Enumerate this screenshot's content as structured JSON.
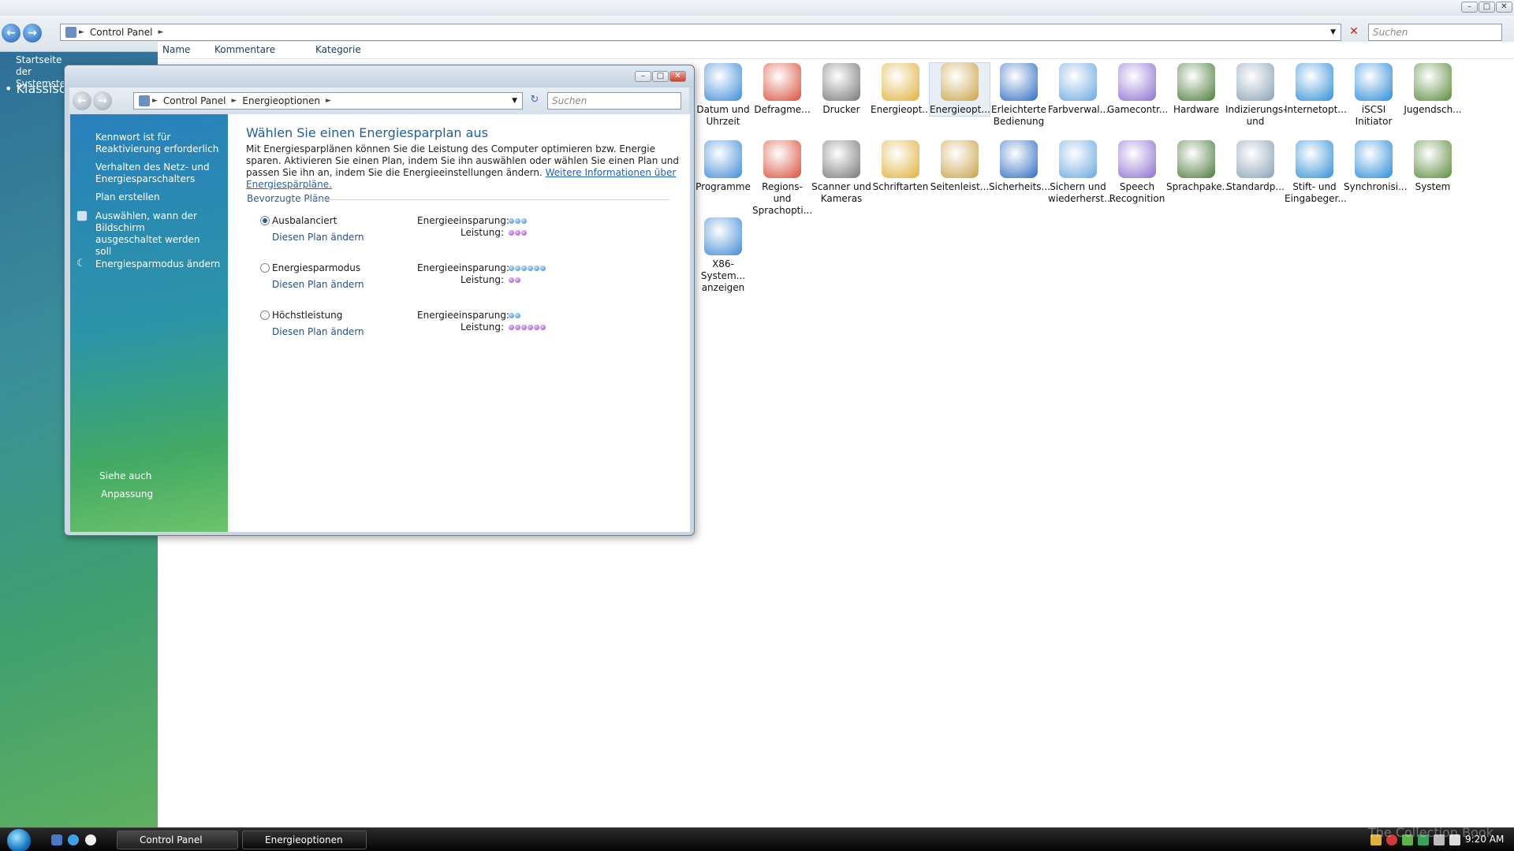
{
  "main": {
    "address": {
      "segments": [
        "Control Panel"
      ]
    },
    "search_placeholder": "Suchen",
    "sidebar": {
      "startseite": "Startseite der Systemsteu",
      "klassisch": "Klassisch"
    },
    "columns": [
      "Name",
      "Kommentare",
      "Kategorie"
    ],
    "items_row1": [
      "Datum und Uhrzeit",
      "Defragme...",
      "Drucker",
      "Energieopt...",
      "Energieopt...",
      "Erleichterte Bedienung",
      "Farbverwal...",
      "Gamecontr...",
      "Hardware",
      "Indizierungs- und",
      "Internetopt...",
      "iSCSI Initiator",
      "Jugendsch..."
    ],
    "items_row2": [
      "Programme",
      "Regions- und Sprachopti...",
      "Scanner und Kameras",
      "Schriftarten",
      "Seitenleist...",
      "Sicherheits...",
      "Sichern und wiederherst...",
      "Speech Recognition",
      "Sprachpake...",
      "Standardp...",
      "Stift- und Eingabeger...",
      "Synchronisi...",
      "System"
    ],
    "items_row3": [
      "X86-System... anzeigen"
    ]
  },
  "power": {
    "address": {
      "segments": [
        "Control Panel",
        "Energieoptionen"
      ]
    },
    "search_placeholder": "Suchen",
    "tasks": [
      "Kennwort ist für Reaktivierung erforderlich",
      "Verhalten des Netz- und Energiesparschalters",
      "Plan erstellen",
      "Auswählen, wann der Bildschirm ausgeschaltet werden soll",
      "Energiesparmodus ändern"
    ],
    "see_also": {
      "heading": "Siehe auch",
      "links": [
        "Anpassung"
      ]
    },
    "title": "Wählen Sie einen Energiesparplan aus",
    "intro": "Mit Energiesparplänen können Sie die Leistung des Computer optimieren bzw. Energie sparen. Aktivieren Sie einen Plan, indem Sie ihn auswählen oder wählen Sie einen Plan und passen Sie ihn an, indem Sie die Energieeinstellungen ändern.",
    "intro_link": "Weitere Informationen über Energiespärpläne.",
    "section": "Bevorzugte Pläne",
    "labels": {
      "savings": "Energieeinsparung:",
      "performance": "Leistung:"
    },
    "plans": [
      {
        "name": "Ausbalanciert",
        "change": "Diesen Plan ändern",
        "savings": 3,
        "performance": 3,
        "selected": true
      },
      {
        "name": "Energiesparmodus",
        "change": "Diesen Plan ändern",
        "savings": 6,
        "performance": 2,
        "selected": false
      },
      {
        "name": "Höchstleistung",
        "change": "Diesen Plan ändern",
        "savings": 2,
        "performance": 6,
        "selected": false
      }
    ]
  },
  "taskbar": {
    "buttons": [
      "Control Panel",
      "Energieoptionen"
    ],
    "clock": "9:20 AM",
    "watermark": "The Collection Book"
  },
  "icons": {
    "back": "back-arrow-icon",
    "forward": "forward-arrow-icon",
    "search": "search-icon",
    "refresh": "refresh-icon",
    "close": "close-icon",
    "minimize": "minimize-icon",
    "maximize": "maximize-icon"
  }
}
